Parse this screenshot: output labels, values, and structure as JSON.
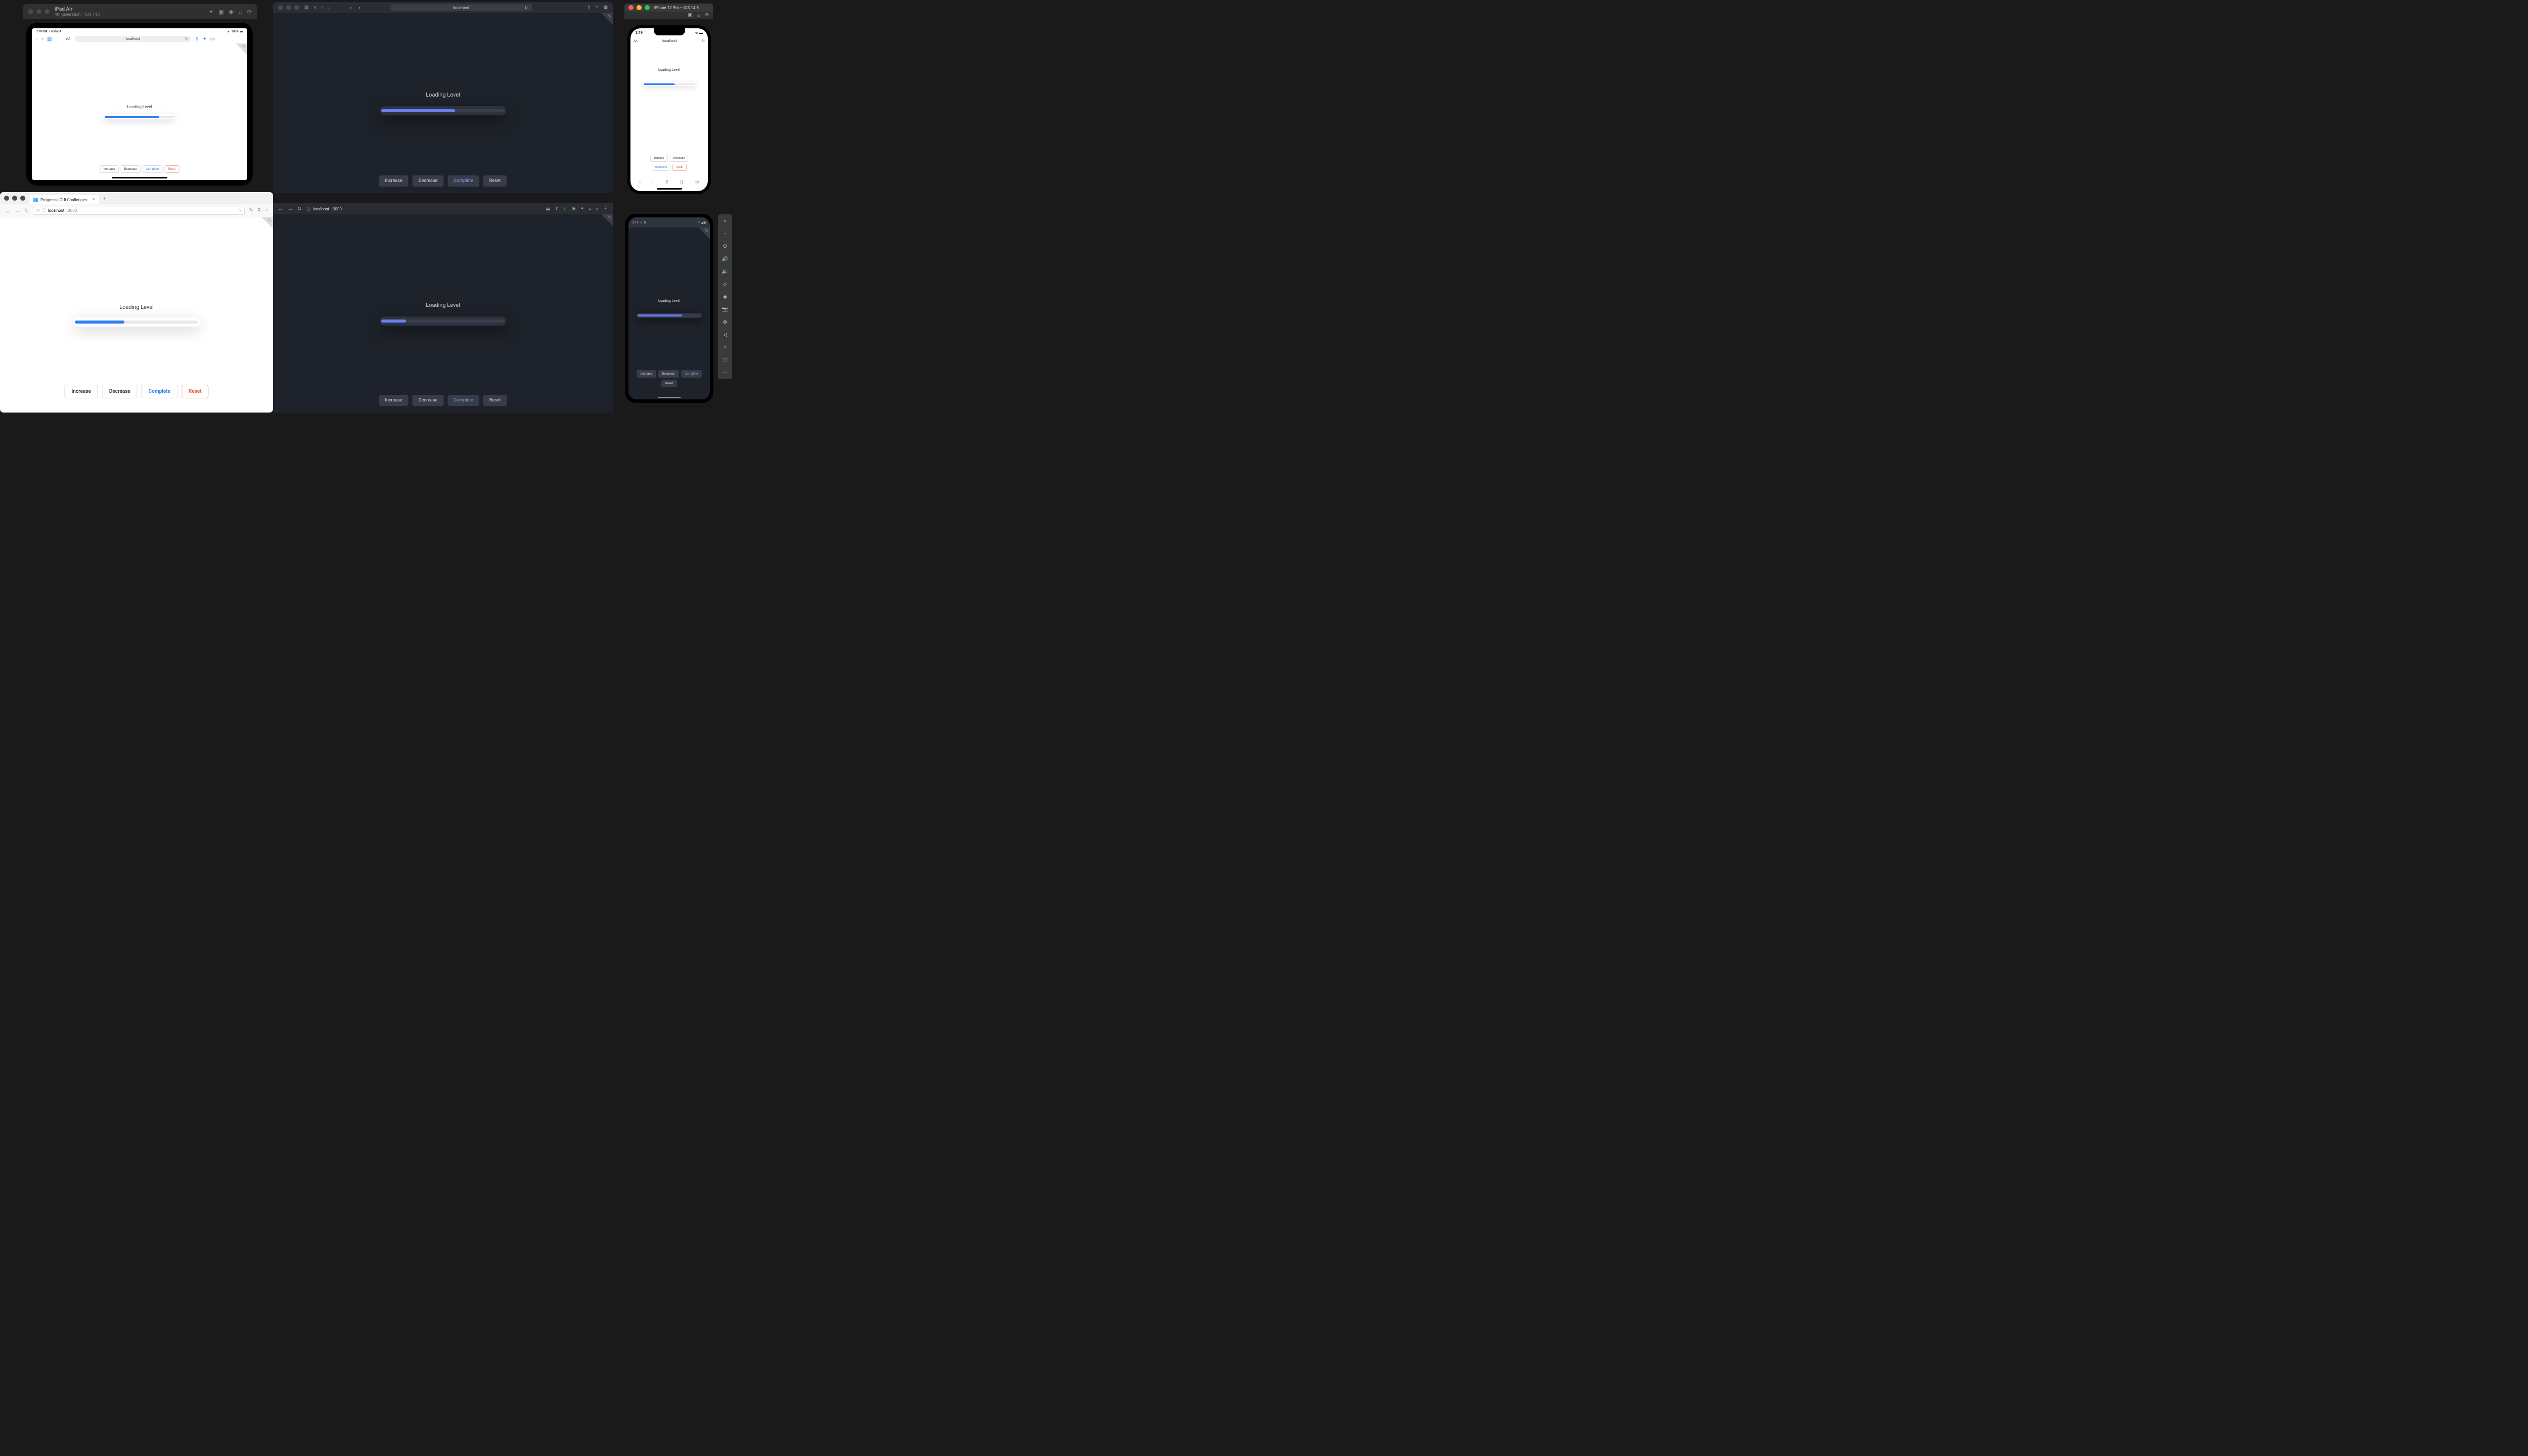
{
  "common": {
    "loading_label": "Loading Level",
    "buttons": {
      "increase": "Increase",
      "decrease": "Decrease",
      "complete": "Complete",
      "reset": "Reset"
    }
  },
  "ipad_sim": {
    "title": "iPad Air",
    "subtitle": "4th generation – iOS 14.5",
    "status_time": "3:19 PM",
    "status_date": "Fri Mar 4",
    "status_battery": "100%",
    "url": "localhost",
    "progress_percent": 78
  },
  "safari_dark": {
    "url": "localhost",
    "progress_percent": 60
  },
  "iphone_sim": {
    "title": "iPhone 12 Pro – iOS 14.5",
    "status_time": "3:19",
    "url": "localhost",
    "progress_percent": 60
  },
  "firefox": {
    "tab_title": "Progress | GUI Challenges",
    "url_host": "localhost",
    "url_port": ":3000",
    "progress_percent": 40
  },
  "chrome_dark": {
    "url_host": "localhost",
    "url_port": ":3000",
    "progress_percent": 20
  },
  "android": {
    "status_time": "3:19",
    "status_icon_count": "8",
    "progress_percent": 70
  }
}
